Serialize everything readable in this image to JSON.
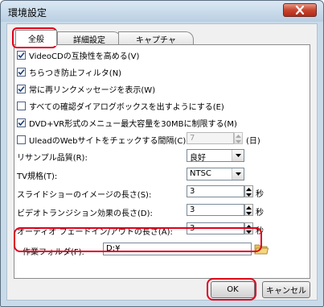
{
  "window": {
    "title": "環境設定"
  },
  "tabs": [
    {
      "label": "全般"
    },
    {
      "label": "詳細設定"
    },
    {
      "label": "キャプチャ"
    }
  ],
  "checkboxes": [
    {
      "label": "VideoCDの互換性を高める(V)",
      "checked": true
    },
    {
      "label": "ちらつき防止フィルタ(N)",
      "checked": true
    },
    {
      "label": "常に再リンクメッセージを表示(W)",
      "checked": true
    },
    {
      "label": "すべての確認ダイアログボックスを出すようにする(E)",
      "checked": false
    },
    {
      "label": "DVD+VR形式のメニュー最大容量を30MBに制限する(M)",
      "checked": true
    },
    {
      "label": "UleadのWebサイトをチェックする間隔(C):",
      "checked": false
    }
  ],
  "web_check": {
    "value": "7",
    "unit": "(日)"
  },
  "resample": {
    "label": "リサンプル品質(R):",
    "value": "良好"
  },
  "tv_standard": {
    "label": "TV規格(T):",
    "value": "NTSC"
  },
  "slideshow": {
    "label": "スライドショーのイメージの長さ(S):",
    "value": "3",
    "unit": "秒"
  },
  "transition": {
    "label": "ビデオトランジション効果の長さ(D):",
    "value": "3",
    "unit": "秒"
  },
  "audio_fade": {
    "label": "オーディオ フェードイン/アウトの長さ(A):",
    "value": "3",
    "unit": "秒"
  },
  "work_folder": {
    "label": "作業フォルダ(F):",
    "value": "D:¥",
    "icon": "folder-icon"
  },
  "buttons": {
    "ok": "OK",
    "cancel": "キャンセル"
  },
  "colors": {
    "highlight": "#e0001b",
    "title_bar": "#c9dbe9",
    "close": "#c8452f"
  }
}
